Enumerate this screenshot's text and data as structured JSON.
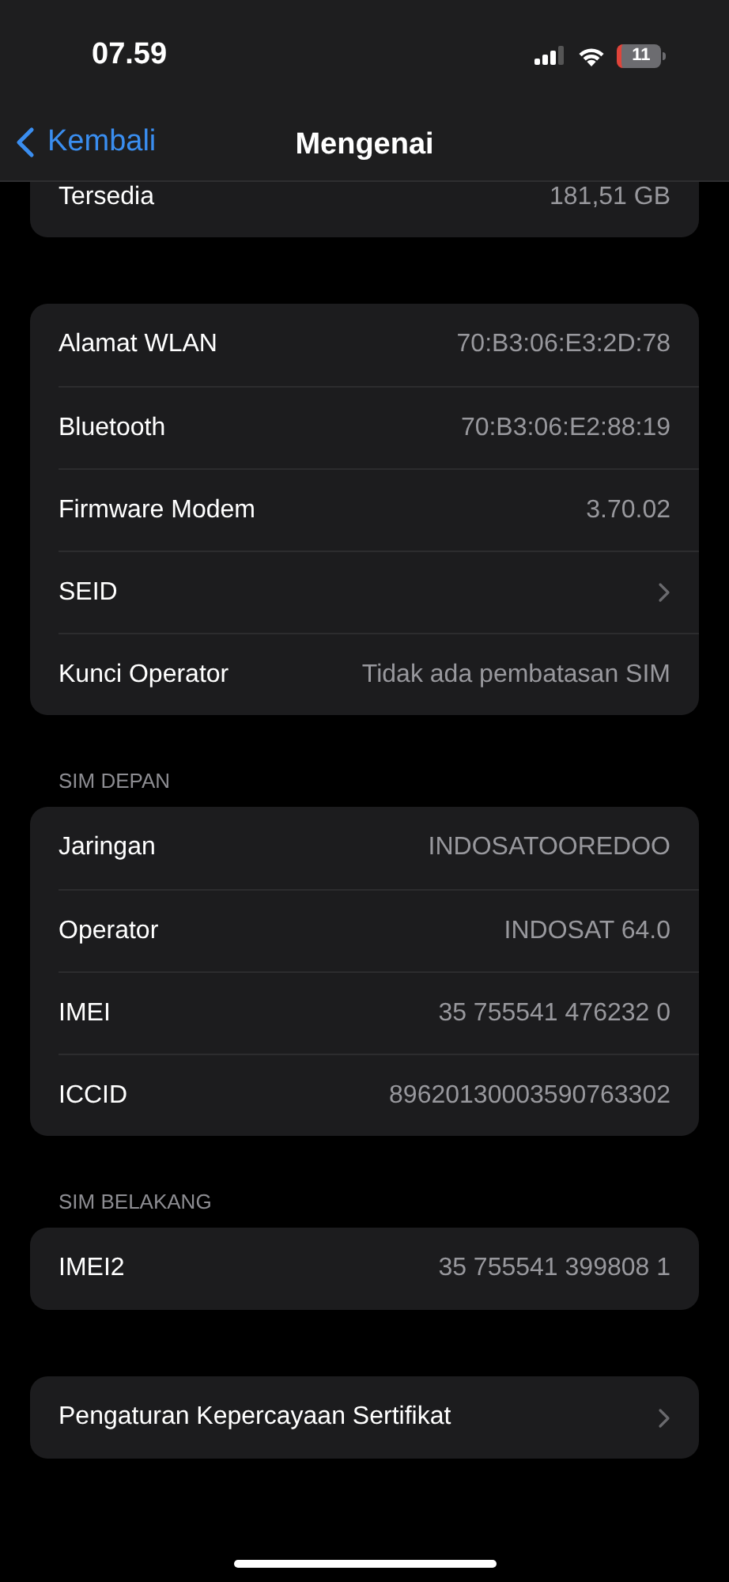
{
  "status_bar": {
    "time": "07.59",
    "battery": "11"
  },
  "nav": {
    "back": "Kembali",
    "title": "Mengenai"
  },
  "sections": [
    {
      "rows": [
        {
          "kind": "value",
          "label": "Tersedia",
          "value": "181,51 GB"
        }
      ],
      "cut_top": true
    },
    {
      "rows": [
        {
          "kind": "value",
          "label": "Alamat WLAN",
          "value": "70:B3:06:E3:2D:78"
        },
        {
          "kind": "value",
          "label": "Bluetooth",
          "value": "70:B3:06:E2:88:19"
        },
        {
          "kind": "value",
          "label": "Firmware Modem",
          "value": "3.70.02"
        },
        {
          "kind": "chevron",
          "label": "SEID"
        },
        {
          "kind": "value",
          "label": "Kunci Operator",
          "value": "Tidak ada pembatasan SIM"
        }
      ]
    },
    {
      "header": "SIM DEPAN",
      "rows": [
        {
          "kind": "value",
          "label": "Jaringan",
          "value": "INDOSATOOREDOO"
        },
        {
          "kind": "value",
          "label": "Operator",
          "value": "INDOSAT 64.0"
        },
        {
          "kind": "value",
          "label": "IMEI",
          "value": "35 755541 476232 0"
        },
        {
          "kind": "value",
          "label": "ICCID",
          "value": "89620130003590763302"
        }
      ]
    },
    {
      "header": "SIM BELAKANG",
      "rows": [
        {
          "kind": "value",
          "label": "IMEI2",
          "value": "35 755541 399808 1"
        }
      ]
    },
    {
      "rows": [
        {
          "kind": "chevron",
          "label": "Pengaturan Kepercayaan Sertifikat"
        }
      ]
    }
  ]
}
